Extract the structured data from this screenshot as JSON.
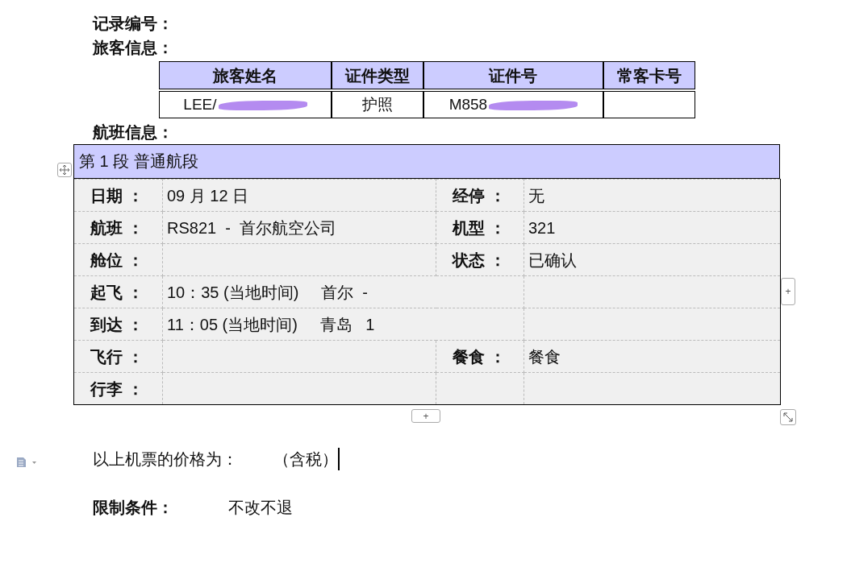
{
  "record_label": "记录编号：",
  "passenger_label": "旅客信息：",
  "passenger_table": {
    "columns": [
      "旅客姓名",
      "证件类型",
      "证件号",
      "常客卡号"
    ],
    "rows": [
      {
        "cells": [
          {
            "text": "LEE/",
            "redacted": true
          },
          {
            "text": "护照",
            "redacted": false
          },
          {
            "text": "M858",
            "redacted": true
          },
          {
            "redacted": false
          }
        ]
      }
    ]
  },
  "flight_label": "航班信息：",
  "segment": {
    "title": "第 1 段  普通航段",
    "rows": [
      {
        "label": "日期 ：",
        "value": "09 月 12 日",
        "label2": "经停 ：",
        "value2": "无"
      },
      {
        "label": "航班 ：",
        "value": "RS821  -  首尔航空公司",
        "label2": "机型 ：",
        "value2": "321"
      },
      {
        "label": "舱位 ：",
        "label2": "状态 ：",
        "value2": "已确认"
      },
      {
        "label": "起飞 ：",
        "value": "10：35 (当地时间)     首尔  -",
        "span": true
      },
      {
        "label": "到达 ：",
        "value": "11：05 (当地时间)     青岛   1",
        "span": true
      },
      {
        "label": "飞行 ：",
        "label2": "餐食 ：",
        "value2": "餐食"
      },
      {
        "label": "行李 ："
      }
    ]
  },
  "add_column_button": "+",
  "add_row_button": "+",
  "price_text": "以上机票的价格为：        （含税）",
  "restriction_label": "限制条件：",
  "restriction_value": "不改不退"
}
